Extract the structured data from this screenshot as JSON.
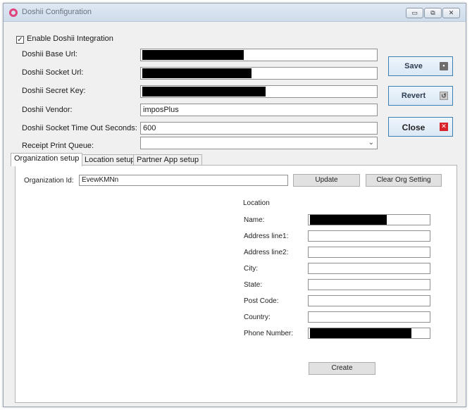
{
  "window": {
    "title": "Doshii Configuration",
    "min_glyph": "▭",
    "max_glyph": "⧉",
    "close_glyph": "✕"
  },
  "enable": {
    "checked_glyph": "✓",
    "label": "Enable Doshii Integration"
  },
  "form": {
    "base_url": {
      "label": "Doshii Base Url:",
      "value": ""
    },
    "socket_url": {
      "label": "Doshii Socket Url:",
      "value": ""
    },
    "secret_key": {
      "label": "Doshii Secret Key:",
      "value": ""
    },
    "vendor": {
      "label": "Doshii Vendor:",
      "value": "imposPlus"
    },
    "timeout": {
      "label": "Doshii Socket Time Out Seconds:",
      "value": "600"
    },
    "print_queue": {
      "label": "Receipt Print Queue:",
      "value": ""
    }
  },
  "actions": {
    "save": "Save",
    "revert": "Revert",
    "close": "Close",
    "save_icon": "floppy-disk-icon",
    "revert_icon": "revert-icon",
    "close_icon": "close-red-icon"
  },
  "tabs": [
    "Organization setup",
    "Location setup",
    "Partner App setup"
  ],
  "org": {
    "id_label": "Organization Id:",
    "id_value": "EvewKMNn",
    "update": "Update",
    "clear": "Clear Org Setting"
  },
  "location": {
    "heading": "Location",
    "fields": [
      {
        "label": "Name:",
        "value": ""
      },
      {
        "label": "Address line1:",
        "value": ""
      },
      {
        "label": "Address line2:",
        "value": ""
      },
      {
        "label": "City:",
        "value": ""
      },
      {
        "label": "State:",
        "value": ""
      },
      {
        "label": "Post Code:",
        "value": ""
      },
      {
        "label": "Country:",
        "value": ""
      },
      {
        "label": "Phone Number:",
        "value": ""
      }
    ],
    "create": "Create"
  }
}
